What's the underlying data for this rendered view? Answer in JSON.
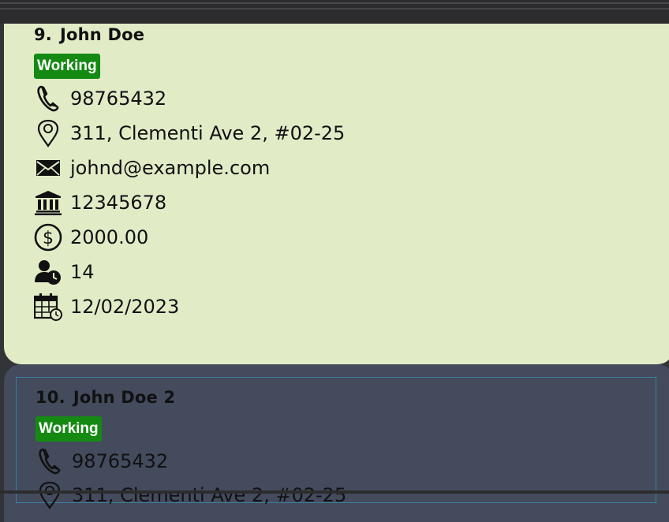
{
  "cards": [
    {
      "index": "9.",
      "name": "John Doe",
      "status": "Working",
      "phone": "98765432",
      "address": "311, Clementi Ave 2, #02-25",
      "email": "johnd@example.com",
      "bank_account": "12345678",
      "salary": "2000.00",
      "leave_days": "14",
      "date": "12/02/2023"
    },
    {
      "index": "10.",
      "name": "John Doe 2",
      "status": "Working",
      "phone": "98765432",
      "address": "311, Clementi Ave 2, #02-25"
    }
  ],
  "colors": {
    "card_bg": "#e1ecc7",
    "selected_card_bg": "#434b5d",
    "badge_bg": "#148a12",
    "app_bg": "#333437"
  },
  "icons": [
    "phone-icon",
    "location-pin-icon",
    "envelope-icon",
    "bank-icon",
    "dollar-coin-icon",
    "person-clock-icon",
    "calendar-clock-icon"
  ]
}
